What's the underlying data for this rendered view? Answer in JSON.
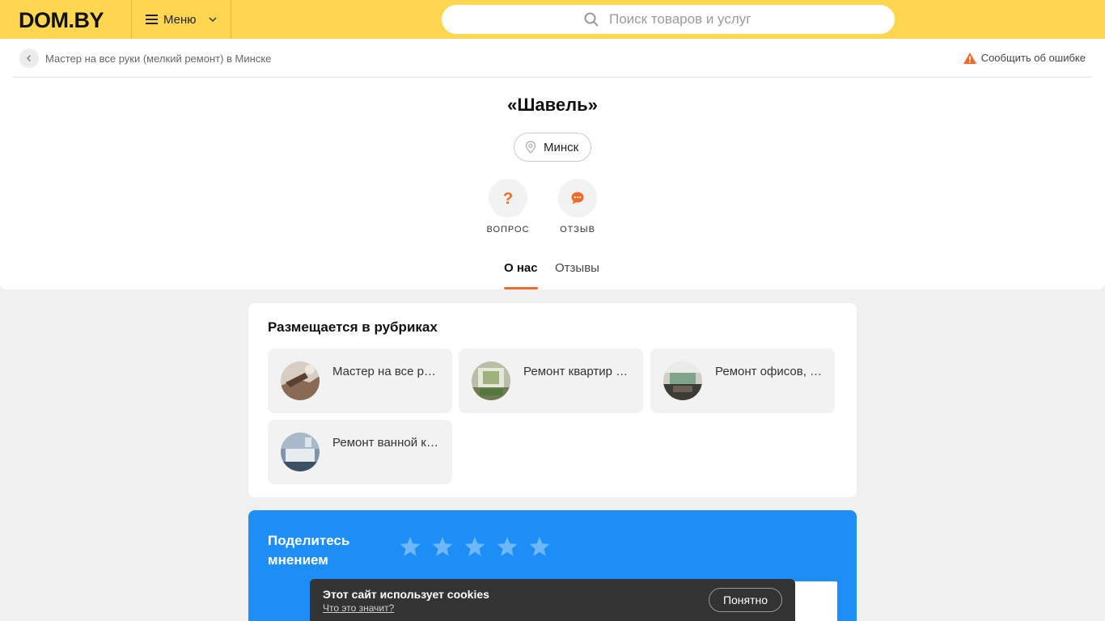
{
  "header": {
    "logo": "DOM.BY",
    "menu_label": "Меню",
    "search_placeholder": "Поиск товаров и услуг",
    "colors": {
      "bar": "#ffd64f"
    }
  },
  "breadcrumb": {
    "link": "Мастер на все руки (мелкий ремонт) в Минске",
    "report": "Сообщить об ошибке"
  },
  "company": {
    "title": "«Шавель»",
    "city": "Минск"
  },
  "actions": {
    "question": "ВОПРОС",
    "review": "ОТЗЫВ"
  },
  "tabs": [
    {
      "label": "О нас",
      "active": true
    },
    {
      "label": "Отзывы",
      "active": false
    }
  ],
  "categories": {
    "title": "Размещается в рубриках",
    "items": [
      {
        "label": "Мастер на все руки (мелкий ремонт)"
      },
      {
        "label": "Ремонт квартир и домов"
      },
      {
        "label": "Ремонт офисов, помещений"
      },
      {
        "label": "Ремонт ванной комнаты"
      }
    ]
  },
  "rating": {
    "title": "Поделитесь мнением",
    "stars_total": 5,
    "accent": "#1e8ef7"
  },
  "cookie": {
    "text": "Этот сайт использует cookies",
    "link": "Что это значит?",
    "button": "Понятно"
  },
  "accent_color": "#f06a2b"
}
